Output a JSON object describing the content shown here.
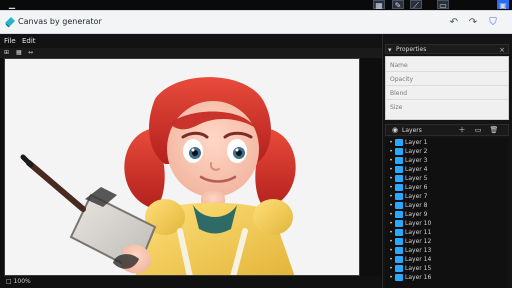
{
  "topbar": {
    "icons": [
      "minimize-icon",
      "clip-icon",
      "pen-icon",
      "gesture-icon",
      "window-icon",
      "panel-toggle-icon"
    ]
  },
  "app": {
    "title": "Canvas by generator"
  },
  "toolbar": {
    "left_label": "File",
    "left_label2": "Edit"
  },
  "canvas": {
    "subject": "A cartoon girl with red pigtails holding a clipboard and a brush."
  },
  "status": {
    "text": "□ 100%"
  },
  "sidebar": {
    "panel_title": "Properties",
    "panel_rows": [
      "Name",
      "Opacity",
      "Blend",
      "Size"
    ],
    "layers_label": "Layers",
    "layers": [
      {
        "name": "Layer 1",
        "color": "#2aa7ff"
      },
      {
        "name": "Layer 2",
        "color": "#2aa7ff"
      },
      {
        "name": "Layer 3",
        "color": "#2aa7ff"
      },
      {
        "name": "Layer 4",
        "color": "#2aa7ff"
      },
      {
        "name": "Layer 5",
        "color": "#2aa7ff"
      },
      {
        "name": "Layer 6",
        "color": "#2aa7ff"
      },
      {
        "name": "Layer 7",
        "color": "#2aa7ff"
      },
      {
        "name": "Layer 8",
        "color": "#2aa7ff"
      },
      {
        "name": "Layer 9",
        "color": "#2aa7ff"
      },
      {
        "name": "Layer 10",
        "color": "#2aa7ff"
      },
      {
        "name": "Layer 11",
        "color": "#2aa7ff"
      },
      {
        "name": "Layer 12",
        "color": "#2aa7ff"
      },
      {
        "name": "Layer 13",
        "color": "#2aa7ff"
      },
      {
        "name": "Layer 14",
        "color": "#2aa7ff"
      },
      {
        "name": "Layer 15",
        "color": "#2aa7ff"
      },
      {
        "name": "Layer 16",
        "color": "#2aa7ff"
      }
    ]
  }
}
